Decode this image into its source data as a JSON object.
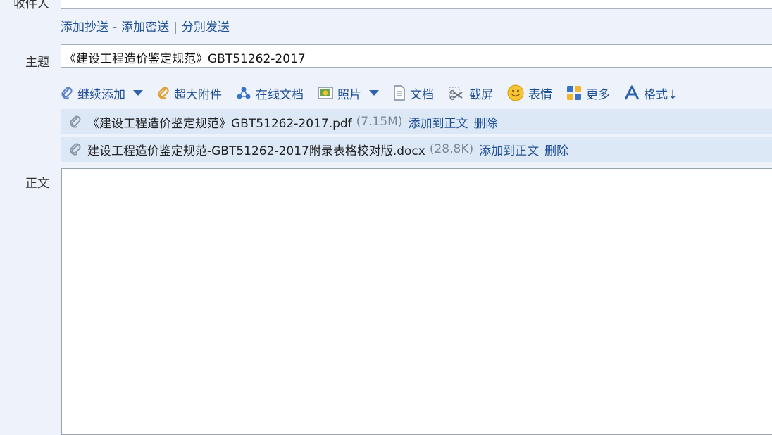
{
  "recipient": {
    "label": "收件人",
    "value": ""
  },
  "recipient_links": {
    "add_cc": "添加抄送",
    "add_bcc": "添加密送",
    "separate_send": "分别发送",
    "dash": "-",
    "pipe": "|"
  },
  "subject": {
    "label": "主题",
    "value": "《建设工程造价鉴定规范》GBT51262-2017"
  },
  "toolbar": {
    "continue_add": "继续添加",
    "large_attachment": "超大附件",
    "online_doc": "在线文档",
    "photo": "照片",
    "document": "文档",
    "screenshot": "截屏",
    "emoji": "表情",
    "more": "更多",
    "format": "格式↓"
  },
  "attachments": [
    {
      "name": "《建设工程造价鉴定规范》GBT51262-2017.pdf",
      "size": "(7.15M)",
      "add_to_body": "添加到正文",
      "delete": "删除"
    },
    {
      "name": "建设工程造价鉴定规范-GBT51262-2017附录表格校对版.docx",
      "size": "(28.8K)",
      "add_to_body": "添加到正文",
      "delete": "删除"
    }
  ],
  "body": {
    "label": "正文",
    "value": ""
  },
  "colors": {
    "background": "#eef3fb",
    "link": "#1f4f95",
    "attachment_row": "#dde8f7",
    "icon_blue": "#2f63b0"
  }
}
